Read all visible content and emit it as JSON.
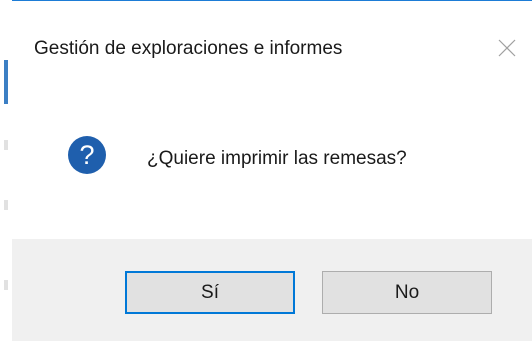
{
  "dialog": {
    "title": "Gestión de exploraciones e informes",
    "message": "¿Quiere imprimir las remesas?",
    "icon": "question-icon",
    "buttons": {
      "yes_label": "Sí",
      "no_label": "No"
    },
    "colors": {
      "accent": "#0078d7",
      "icon_fill": "#1f5fad",
      "footer_bg": "#f0f0f0",
      "button_bg": "#e1e1e1"
    }
  }
}
